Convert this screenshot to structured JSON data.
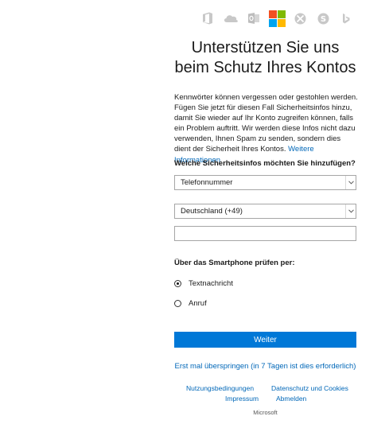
{
  "header": {
    "icons": [
      "office-icon",
      "onedrive-icon",
      "outlook-icon",
      "microsoft-logo",
      "xbox-icon",
      "skype-icon",
      "bing-icon"
    ]
  },
  "title": {
    "line1": "Unterstützen Sie uns",
    "line2": "beim Schutz Ihres Kontos"
  },
  "description": {
    "text": "Kennwörter können vergessen oder gestohlen werden. Fügen Sie jetzt für diesen Fall Sicherheitsinfos hinzu, damit Sie wieder auf Ihr Konto zugreifen können, falls ein Problem auftritt. Wir werden diese Infos nicht dazu verwenden, Ihnen Spam zu senden, sondern dies dient der Sicherheit Ihres Kontos.",
    "link": "Weitere Informationen"
  },
  "form": {
    "question": "Welche Sicherheitsinfos möchten Sie hinzufügen?",
    "type_select": "Telefonnummer",
    "country_select": "Deutschland (+49)",
    "phone_value": "",
    "verify_label": "Über das Smartphone prüfen per:",
    "radio_sms": "Textnachricht",
    "radio_call": "Anruf",
    "next_button": "Weiter",
    "skip_link": "Erst mal überspringen (in 7 Tagen ist dies erforderlich)"
  },
  "footer": {
    "terms": "Nutzungsbedingungen",
    "privacy": "Datenschutz und Cookies",
    "imprint": "Impressum",
    "signout": "Abmelden",
    "brand": "Microsoft"
  },
  "colors": {
    "accent": "#0078d7",
    "link": "#0067b8",
    "ms_red": "#f25022",
    "ms_green": "#7fba00",
    "ms_blue": "#00a4ef",
    "ms_yellow": "#ffb900"
  }
}
